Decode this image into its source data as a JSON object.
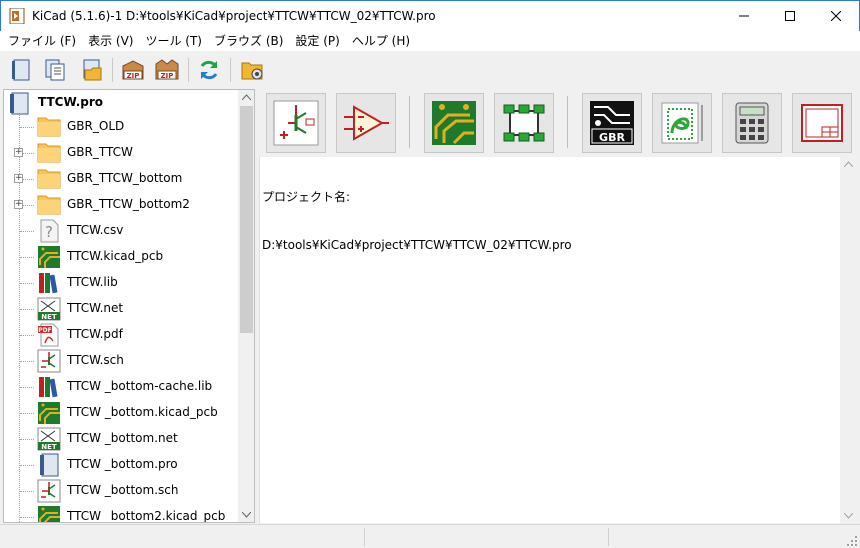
{
  "window": {
    "title": "KiCad (5.1.6)-1 D:¥tools¥KiCad¥project¥TTCW¥TTCW_02¥TTCW.pro"
  },
  "menu": [
    {
      "label": "ファイル (F)"
    },
    {
      "label": "表示 (V)"
    },
    {
      "label": "ツール (T)"
    },
    {
      "label": "ブラウズ (B)"
    },
    {
      "label": "設定 (P)"
    },
    {
      "label": "ヘルプ (H)"
    }
  ],
  "tree": {
    "root": "TTCW.pro",
    "items": [
      {
        "label": "GBR_OLD",
        "icon": "folder-icon",
        "expandable": false
      },
      {
        "label": "GBR_TTCW",
        "icon": "folder-icon",
        "expandable": true
      },
      {
        "label": "GBR_TTCW_bottom",
        "icon": "folder-icon",
        "expandable": true
      },
      {
        "label": "GBR_TTCW_bottom2",
        "icon": "folder-icon",
        "expandable": true
      },
      {
        "label": "TTCW.csv",
        "icon": "unknown-file-icon",
        "expandable": false
      },
      {
        "label": "TTCW.kicad_pcb",
        "icon": "pcb-file-icon",
        "expandable": false
      },
      {
        "label": "TTCW.lib",
        "icon": "library-file-icon",
        "expandable": false
      },
      {
        "label": "TTCW.net",
        "icon": "netlist-file-icon",
        "expandable": false
      },
      {
        "label": "TTCW.pdf",
        "icon": "pdf-file-icon",
        "expandable": false
      },
      {
        "label": "TTCW.sch",
        "icon": "schematic-file-icon",
        "expandable": false
      },
      {
        "label": "TTCW _bottom-cache.lib",
        "icon": "library-file-icon",
        "expandable": false
      },
      {
        "label": "TTCW _bottom.kicad_pcb",
        "icon": "pcb-file-icon",
        "expandable": false
      },
      {
        "label": "TTCW _bottom.net",
        "icon": "netlist-file-icon",
        "expandable": false
      },
      {
        "label": "TTCW _bottom.pro",
        "icon": "project-file-icon",
        "expandable": false
      },
      {
        "label": "TTCW _bottom.sch",
        "icon": "schematic-file-icon",
        "expandable": false
      },
      {
        "label": "TTCW _bottom2.kicad_pcb",
        "icon": "pcb-file-icon",
        "expandable": false
      }
    ]
  },
  "messages": {
    "line1": "プロジェクト名:",
    "line2": "D:¥tools¥KiCad¥project¥TTCW¥TTCW_02¥TTCW.pro"
  },
  "colors": {
    "accent": "#2b79d6",
    "pcb_green": "#1f7a2c",
    "folder": "#f7c65a"
  }
}
